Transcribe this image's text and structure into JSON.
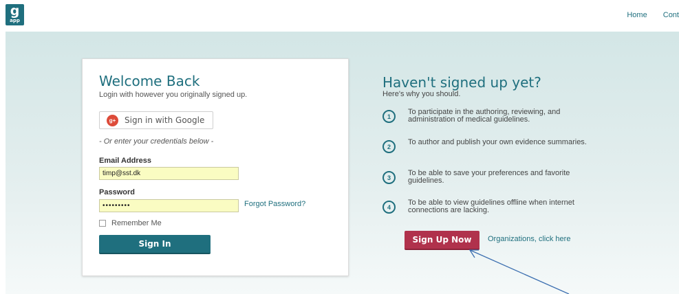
{
  "header": {
    "logo_big": "g",
    "logo_small": "app",
    "nav": {
      "home": "Home",
      "contact": "Cont"
    }
  },
  "login": {
    "title": "Welcome Back",
    "subtitle": "Login with however you originally signed up.",
    "google_button": "Sign in with Google",
    "google_icon_text": "g+",
    "divider": "- Or enter your credentials below -",
    "email_label": "Email Address",
    "email_value": "timp@sst.dk",
    "password_label": "Password",
    "password_value": "•••••••••",
    "forgot_link": "Forgot Password?",
    "remember_label": "Remember Me",
    "signin_button": "Sign In"
  },
  "promo": {
    "title": "Haven't signed up yet?",
    "subtitle": "Here's why you should.",
    "reasons": [
      {
        "num": "1",
        "text": "To participate in the authoring, reviewing, and administration of medical guidelines."
      },
      {
        "num": "2",
        "text": "To author and publish your own evidence summaries."
      },
      {
        "num": "3",
        "text": "To be able to save your preferences and favorite guidelines."
      },
      {
        "num": "4",
        "text": "To be able to view guidelines offline when internet connections are lacking."
      }
    ],
    "signup_button": "Sign Up Now",
    "org_link": "Organizations, click here"
  },
  "colors": {
    "brand": "#1f6f7e",
    "signup": "#b0324c",
    "autofill": "#fafcc2",
    "google": "#dd4b39",
    "annotation": "#3c6fb0"
  }
}
